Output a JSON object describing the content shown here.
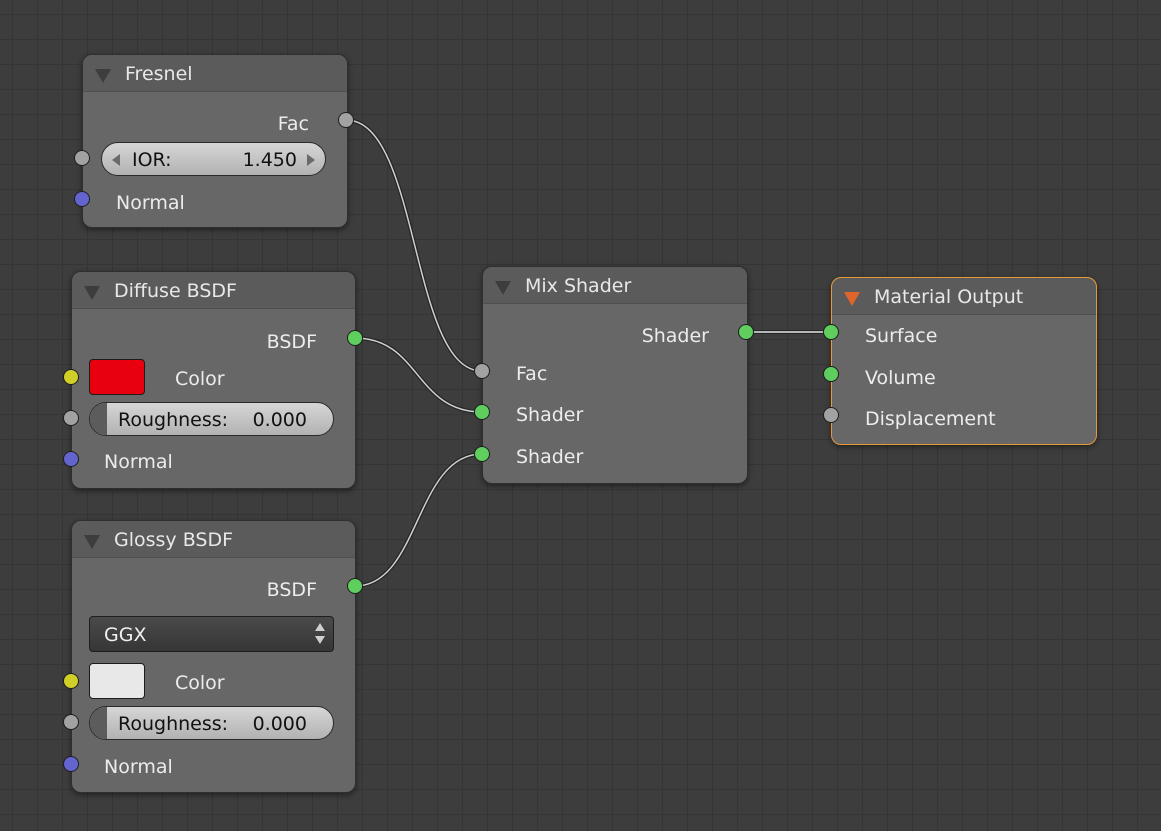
{
  "nodes": {
    "fresnel": {
      "title": "Fresnel",
      "output_fac": "Fac",
      "ior_label": "IOR:",
      "ior_value": "1.450",
      "normal_label": "Normal"
    },
    "diffuse": {
      "title": "Diffuse BSDF",
      "output_bsdf": "BSDF",
      "color_label": "Color",
      "color_value": "#e8000e",
      "roughness_label": "Roughness:",
      "roughness_value": "0.000",
      "normal_label": "Normal"
    },
    "glossy": {
      "title": "Glossy BSDF",
      "output_bsdf": "BSDF",
      "distribution": "GGX",
      "color_label": "Color",
      "color_value": "#e8e8e8",
      "roughness_label": "Roughness:",
      "roughness_value": "0.000",
      "normal_label": "Normal"
    },
    "mix_shader": {
      "title": "Mix Shader",
      "output_shader": "Shader",
      "input_fac": "Fac",
      "input_shader_1": "Shader",
      "input_shader_2": "Shader"
    },
    "material_output": {
      "title": "Material Output",
      "input_surface": "Surface",
      "input_volume": "Volume",
      "input_displacement": "Displacement"
    }
  },
  "colors": {
    "node_active_border": "#e59a3a",
    "socket_shader": "#5fce5f",
    "socket_color": "#cfcf28",
    "socket_vector": "#6464cf",
    "socket_value": "#a2a2a2"
  }
}
